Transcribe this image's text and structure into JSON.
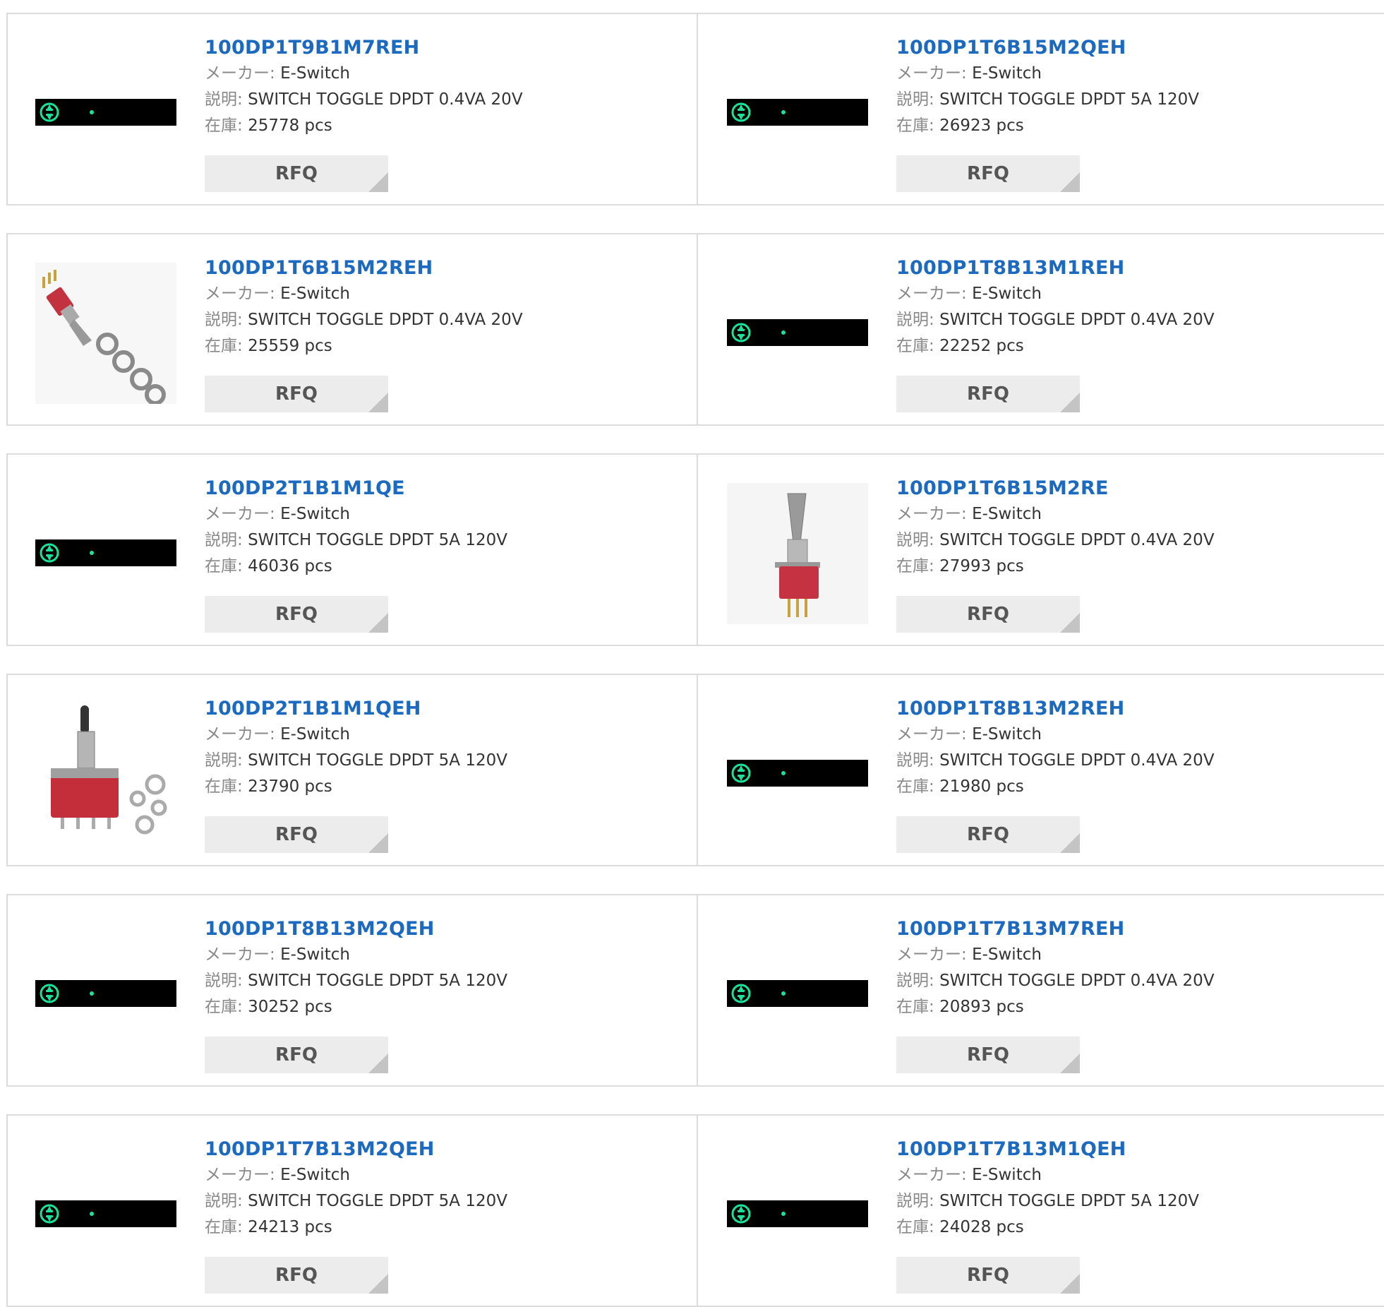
{
  "labels": {
    "maker": "メーカー:",
    "desc": "説明:",
    "stock": "在庫:",
    "rfq": "RFQ"
  },
  "products": [
    {
      "part": "100DP1T9B1M7REH",
      "maker": "E-Switch",
      "desc": "SWITCH TOGGLE DPDT 0.4VA 20V",
      "stock": "25778 pcs",
      "image": "placeholder-banner"
    },
    {
      "part": "100DP1T6B15M2QEH",
      "maker": "E-Switch",
      "desc": "SWITCH TOGGLE DPDT 5A 120V",
      "stock": "26923 pcs",
      "image": "placeholder-banner"
    },
    {
      "part": "100DP1T6B15M2REH",
      "maker": "E-Switch",
      "desc": "SWITCH TOGGLE DPDT 0.4VA 20V",
      "stock": "25559 pcs",
      "image": "toggle-switch-with-nuts-photo"
    },
    {
      "part": "100DP1T8B13M1REH",
      "maker": "E-Switch",
      "desc": "SWITCH TOGGLE DPDT 0.4VA 20V",
      "stock": "22252 pcs",
      "image": "placeholder-banner"
    },
    {
      "part": "100DP2T1B1M1QE",
      "maker": "E-Switch",
      "desc": "SWITCH TOGGLE DPDT 5A 120V",
      "stock": "46036 pcs",
      "image": "placeholder-banner"
    },
    {
      "part": "100DP1T6B15M2RE",
      "maker": "E-Switch",
      "desc": "SWITCH TOGGLE DPDT 0.4VA 20V",
      "stock": "27993 pcs",
      "image": "toggle-switch-photo"
    },
    {
      "part": "100DP2T1B1M1QEH",
      "maker": "E-Switch",
      "desc": "SWITCH TOGGLE DPDT 5A 120V",
      "stock": "23790 pcs",
      "image": "toggle-switch-with-washers-photo"
    },
    {
      "part": "100DP1T8B13M2REH",
      "maker": "E-Switch",
      "desc": "SWITCH TOGGLE DPDT 0.4VA 20V",
      "stock": "21980 pcs",
      "image": "placeholder-banner"
    },
    {
      "part": "100DP1T8B13M2QEH",
      "maker": "E-Switch",
      "desc": "SWITCH TOGGLE DPDT 5A 120V",
      "stock": "30252 pcs",
      "image": "placeholder-banner"
    },
    {
      "part": "100DP1T7B13M7REH",
      "maker": "E-Switch",
      "desc": "SWITCH TOGGLE DPDT 0.4VA 20V",
      "stock": "20893 pcs",
      "image": "placeholder-banner"
    },
    {
      "part": "100DP1T7B13M2QEH",
      "maker": "E-Switch",
      "desc": "SWITCH TOGGLE DPDT 5A 120V",
      "stock": "24213 pcs",
      "image": "placeholder-banner"
    },
    {
      "part": "100DP1T7B13M1QEH",
      "maker": "E-Switch",
      "desc": "SWITCH TOGGLE DPDT 5A 120V",
      "stock": "24028 pcs",
      "image": "placeholder-banner"
    }
  ],
  "colors": {
    "link": "#1b6ac0",
    "banner_bg": "#000000",
    "banner_icon": "#19e39a",
    "button_bg": "#ececec",
    "border": "#dcdcdc"
  }
}
